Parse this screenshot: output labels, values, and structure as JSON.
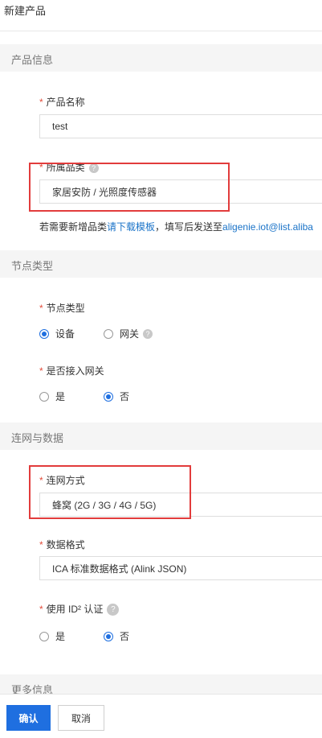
{
  "header": {
    "title": "新建产品"
  },
  "sections": {
    "product_info": "产品信息",
    "node_type": "节点类型",
    "network_data": "连网与数据",
    "more_info": "更多信息"
  },
  "required_mark": "*",
  "help_glyph": "?",
  "form": {
    "product_name": {
      "label": "产品名称",
      "value": "test"
    },
    "category": {
      "label": "所属品类",
      "value": "家居安防 / 光照度传感器"
    },
    "category_hint": {
      "prefix": "若需要新增品类",
      "link": "请下载模板",
      "middle": "，填写后发送至",
      "email": "aligenie.iot@list.aliba"
    },
    "node_type": {
      "label": "节点类型",
      "options": [
        {
          "label": "设备",
          "selected": true
        },
        {
          "label": "网关",
          "selected": false
        }
      ]
    },
    "gateway_access": {
      "label": "是否接入网关",
      "options": [
        {
          "label": "是",
          "selected": false
        },
        {
          "label": "否",
          "selected": true
        }
      ]
    },
    "network_method": {
      "label": "连网方式",
      "value": "蜂窝 (2G / 3G / 4G / 5G)"
    },
    "data_format": {
      "label": "数据格式",
      "value": "ICA 标准数据格式 (Alink JSON)"
    },
    "id2_auth": {
      "label": "使用 ID² 认证",
      "options": [
        {
          "label": "是",
          "selected": false
        },
        {
          "label": "否",
          "selected": true
        }
      ]
    }
  },
  "footer": {
    "confirm": "确认",
    "cancel": "取消"
  },
  "colors": {
    "primary": "#1f6fe0",
    "required": "#e34d3b",
    "highlight": "#e23c3c",
    "link": "#1a73c8"
  }
}
